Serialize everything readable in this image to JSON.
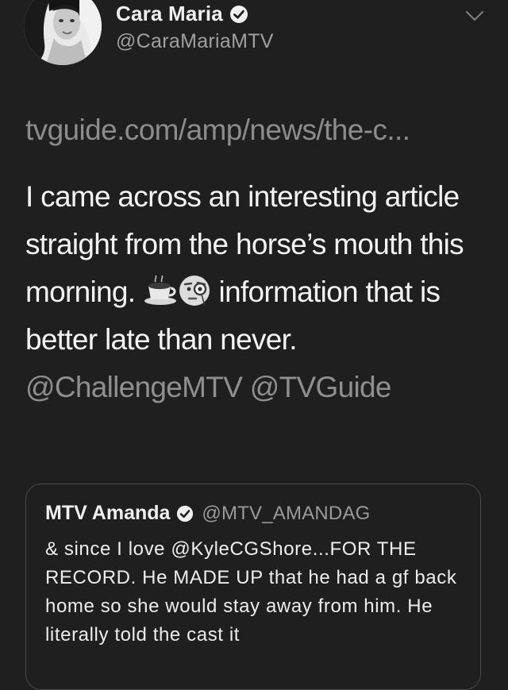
{
  "author": {
    "display_name": "Cara Maria",
    "handle": "@CaraMariaMTV",
    "verified_icon": "verified-badge-icon",
    "menu_icon": "chevron-down-icon"
  },
  "tweet": {
    "link_preview": "tvguide.com/amp/news/the-c...",
    "text_part1": "I came across an interesting article straight from the horse’s mouth this morning.",
    "emoji_1": "coffee-cup-emoji",
    "emoji_2": "face-with-monocle-emoji",
    "text_part2": "information that is better late than never.",
    "mention_1": "@ChallengeMTV",
    "mention_2": "@TVGuide"
  },
  "quoted_tweet": {
    "display_name": "MTV Amanda",
    "handle": "@MTV_AMANDAG",
    "text": "& since I love @KyleCGShore...FOR THE RECORD. He MADE UP that he had a gf back home so she would stay away from him. He literally told the cast it"
  },
  "colors": {
    "background": "#1f1f1f",
    "primary_text": "#f4f4f4",
    "secondary_text": "#8f8f8f",
    "quote_border": "#4a4a4a"
  }
}
